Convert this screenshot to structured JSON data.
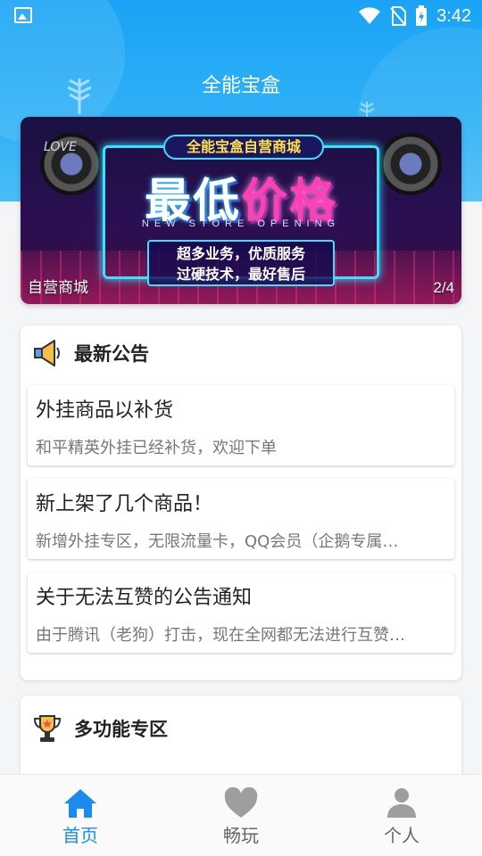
{
  "status_bar": {
    "time": "3:42"
  },
  "app": {
    "title": "全能宝盒"
  },
  "banner": {
    "shop_title": "全能宝盒自营商城",
    "headline_a": "最低",
    "headline_b": "价格",
    "subtitle_en": "NEW STORE OPENING",
    "slogan_line1": "超多业务，优质服务",
    "slogan_line2": "过硬技术，最好售后",
    "caption": "自营商城",
    "pager": "2/4",
    "deco_text": "LOVE"
  },
  "notice": {
    "title": "最新公告",
    "items": [
      {
        "title": "外挂商品以补货",
        "desc": "和平精英外挂已经补货，欢迎下单"
      },
      {
        "title": "新上架了几个商品！",
        "desc": "新增外挂专区，无限流量卡，QQ会员（企鹅专属…"
      },
      {
        "title": "关于无法互赞的公告通知",
        "desc": "由于腾讯（老狗）打击，现在全网都无法进行互赞…"
      }
    ]
  },
  "multi": {
    "title": "多功能专区"
  },
  "nav": {
    "items": [
      {
        "label": "首页",
        "icon": "home-icon",
        "active": true
      },
      {
        "label": "畅玩",
        "icon": "heart-icon",
        "active": false
      },
      {
        "label": "个人",
        "icon": "person-icon",
        "active": false
      }
    ]
  },
  "colors": {
    "accent": "#1a8cf0",
    "header": "#1aa3f5"
  }
}
